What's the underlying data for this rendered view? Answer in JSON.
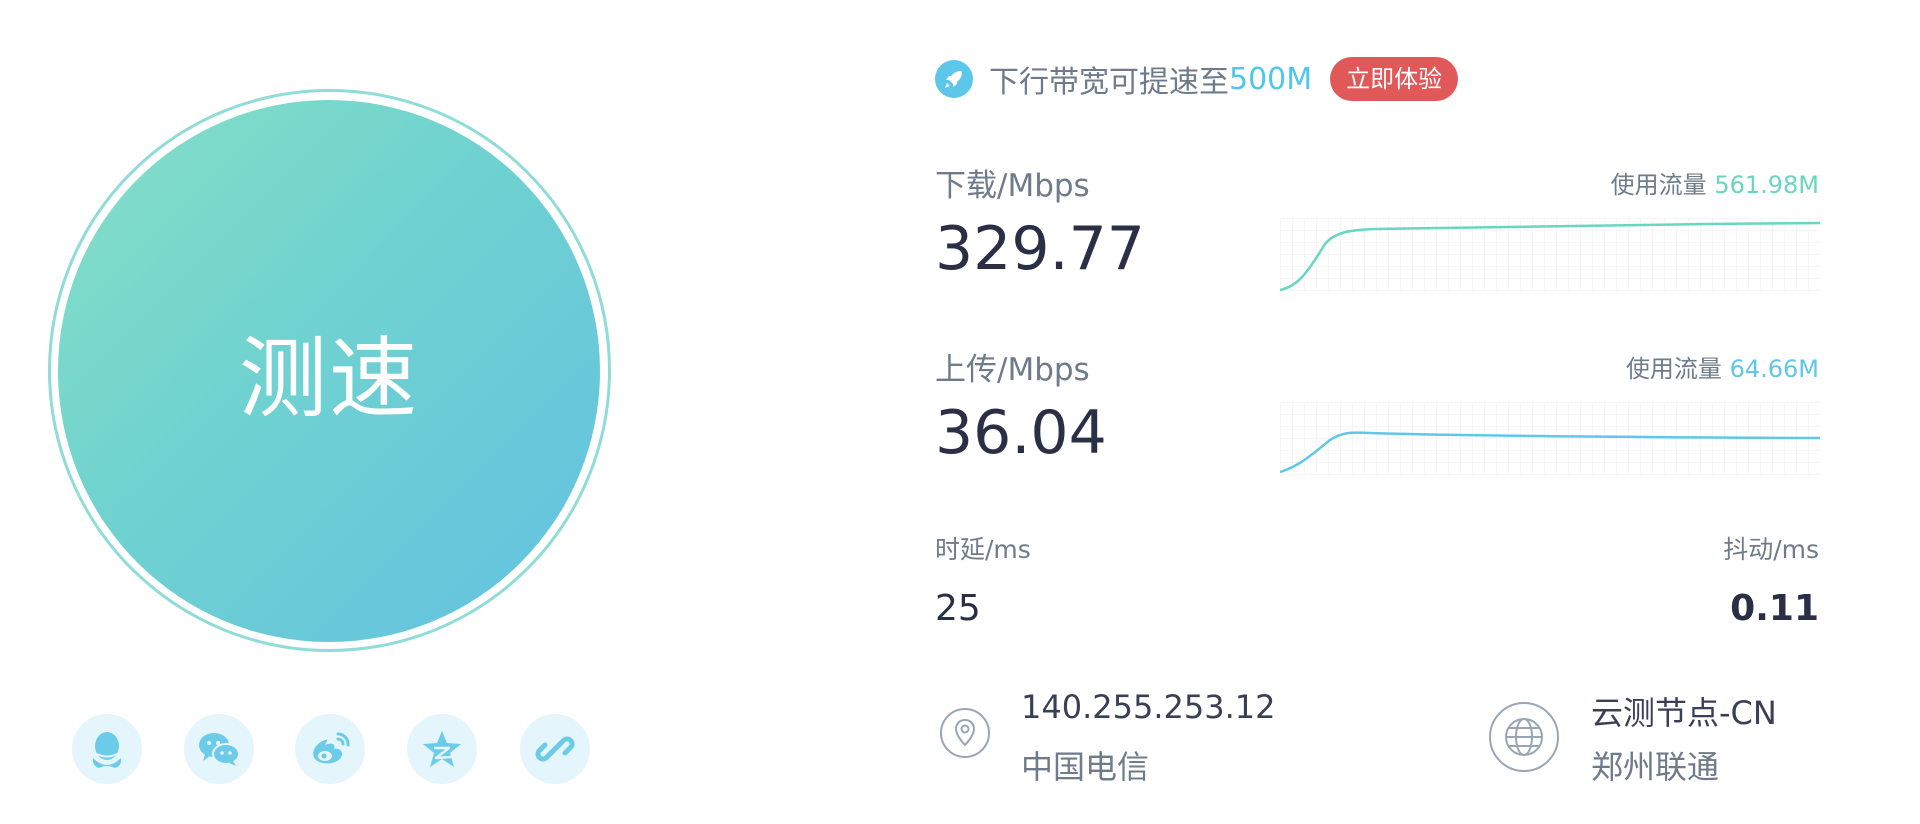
{
  "main_button": {
    "label": "测速"
  },
  "share": {
    "items": [
      {
        "icon": "qq-icon"
      },
      {
        "icon": "wechat-icon"
      },
      {
        "icon": "weibo-icon"
      },
      {
        "icon": "qzone-icon"
      },
      {
        "icon": "link-icon"
      }
    ]
  },
  "promo": {
    "icon": "rocket-icon",
    "text": "下行带宽可提速至",
    "highlight": "500M",
    "button_label": "立即体验",
    "button_color": "#e15858",
    "highlight_color": "#4fc6ee"
  },
  "download": {
    "label": "下载/Mbps",
    "value": "329.77",
    "usage_label": "使用流量",
    "usage_value": "561.98M",
    "color": "#69d6bf"
  },
  "upload": {
    "label": "上传/Mbps",
    "value": "36.04",
    "usage_label": "使用流量",
    "usage_value": "64.66M",
    "color": "#61c7e6"
  },
  "latency": {
    "label": "时延/ms",
    "value": "25"
  },
  "jitter": {
    "label": "抖动/ms",
    "value": "0.11"
  },
  "client": {
    "icon": "location-pin-icon",
    "ip": "140.255.253.12",
    "isp": "中国电信"
  },
  "server": {
    "icon": "globe-icon",
    "node": "云测节点-CN",
    "location": "郑州联通"
  }
}
